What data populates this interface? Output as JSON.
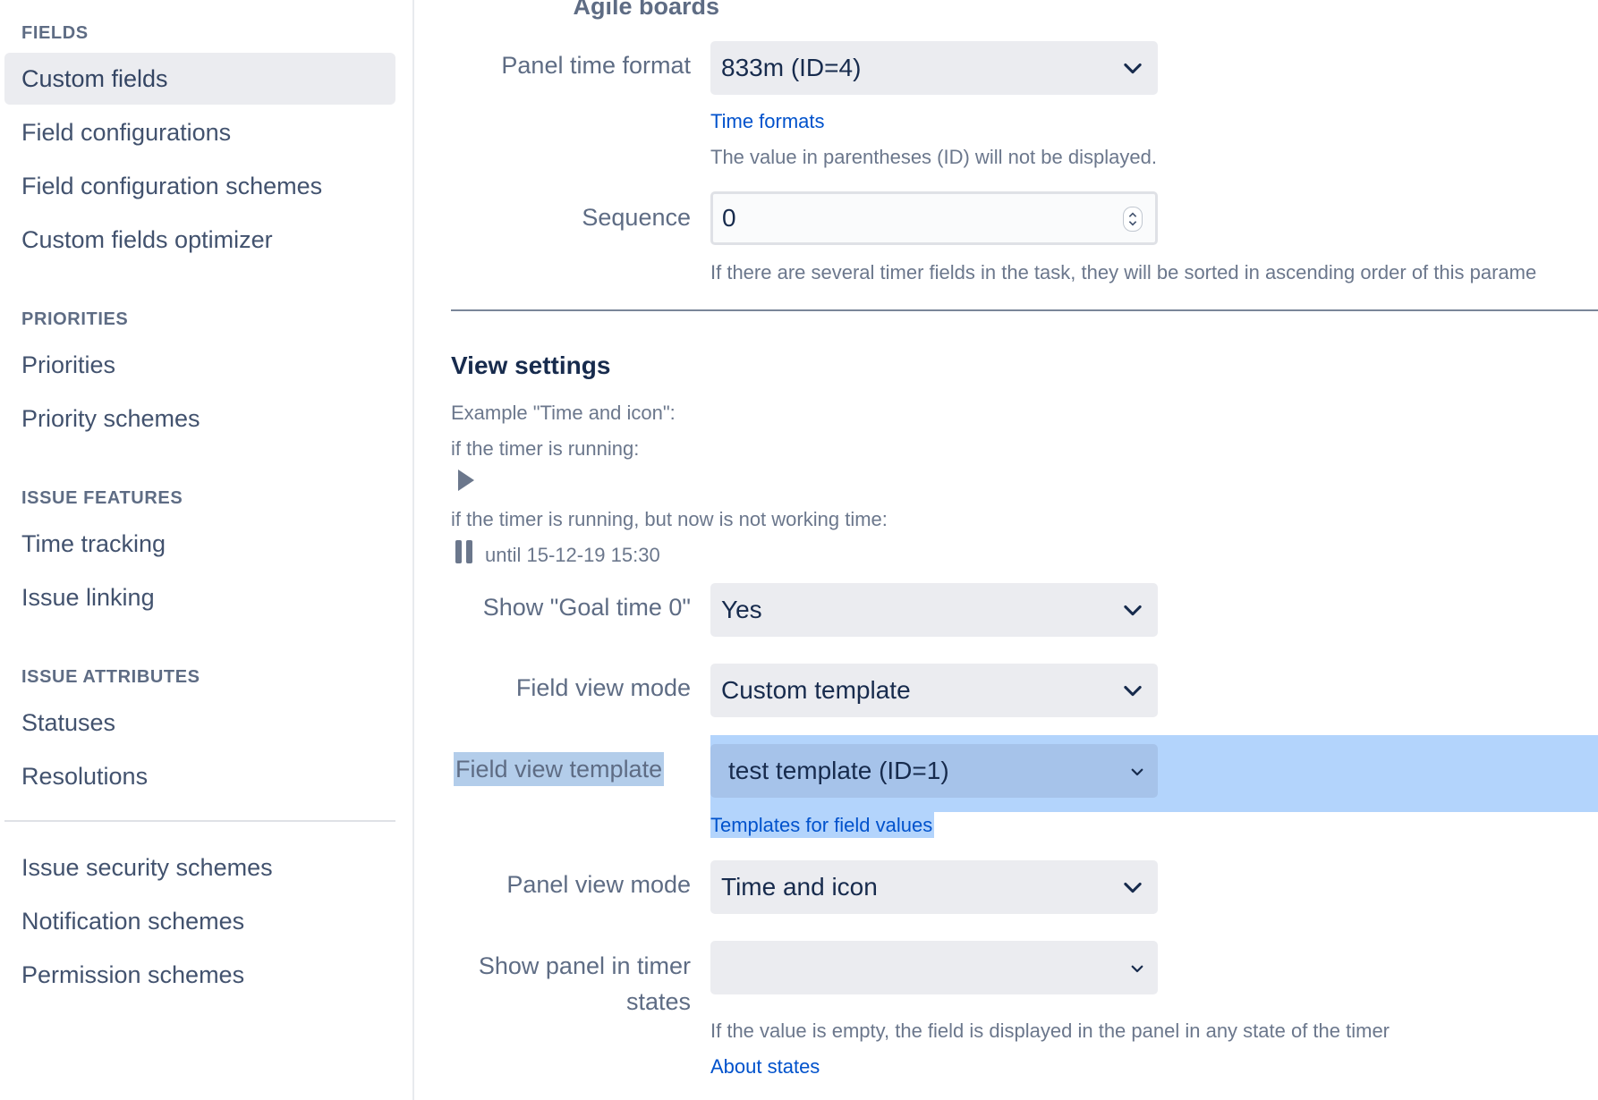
{
  "sidebar": {
    "sections": [
      {
        "header": "FIELDS",
        "items": [
          "Custom fields",
          "Field configurations",
          "Field configuration schemes",
          "Custom fields optimizer"
        ]
      },
      {
        "header": "PRIORITIES",
        "items": [
          "Priorities",
          "Priority schemes"
        ]
      },
      {
        "header": "ISSUE FEATURES",
        "items": [
          "Time tracking",
          "Issue linking"
        ]
      },
      {
        "header": "ISSUE ATTRIBUTES",
        "items": [
          "Statuses",
          "Resolutions"
        ]
      },
      {
        "header": "",
        "items": [
          "Issue security schemes",
          "Notification schemes",
          "Permission schemes"
        ]
      }
    ],
    "selected": "Custom fields"
  },
  "main": {
    "top_cut_label": "Agile boards",
    "panel_time_format": {
      "label": "Panel time format",
      "value": "833m (ID=4)",
      "link": "Time formats",
      "help": "The value in parentheses (ID) will not be displayed."
    },
    "sequence": {
      "label": "Sequence",
      "value": "0",
      "help": "If there are several timer fields in the task, they will be sorted in ascending order of this parame"
    },
    "view_settings": {
      "title": "View settings",
      "example_label": "Example \"Time and icon\":",
      "running_label": "if the timer is running:",
      "not_working_label": "if the timer is running, but now is not working time:",
      "until_text": "until 15-12-19 15:30"
    },
    "show_goal_time": {
      "label": "Show \"Goal time 0\"",
      "value": "Yes"
    },
    "field_view_mode": {
      "label": "Field view mode",
      "value": "Custom template"
    },
    "field_view_template": {
      "label": "Field view template",
      "value": "test template (ID=1)",
      "link": "Templates for field values"
    },
    "panel_view_mode": {
      "label": "Panel view mode",
      "value": "Time and icon"
    },
    "show_panel_states": {
      "label_line1": "Show panel in timer",
      "label_line2": "states",
      "value": "",
      "help": "If the value is empty, the field is displayed in the panel in any state of the timer",
      "link": "About states"
    }
  },
  "colors": {
    "link": "#0052cc",
    "selection_highlight": "#b3d4fc",
    "sidebar_selected_bg": "#ebecf0"
  }
}
